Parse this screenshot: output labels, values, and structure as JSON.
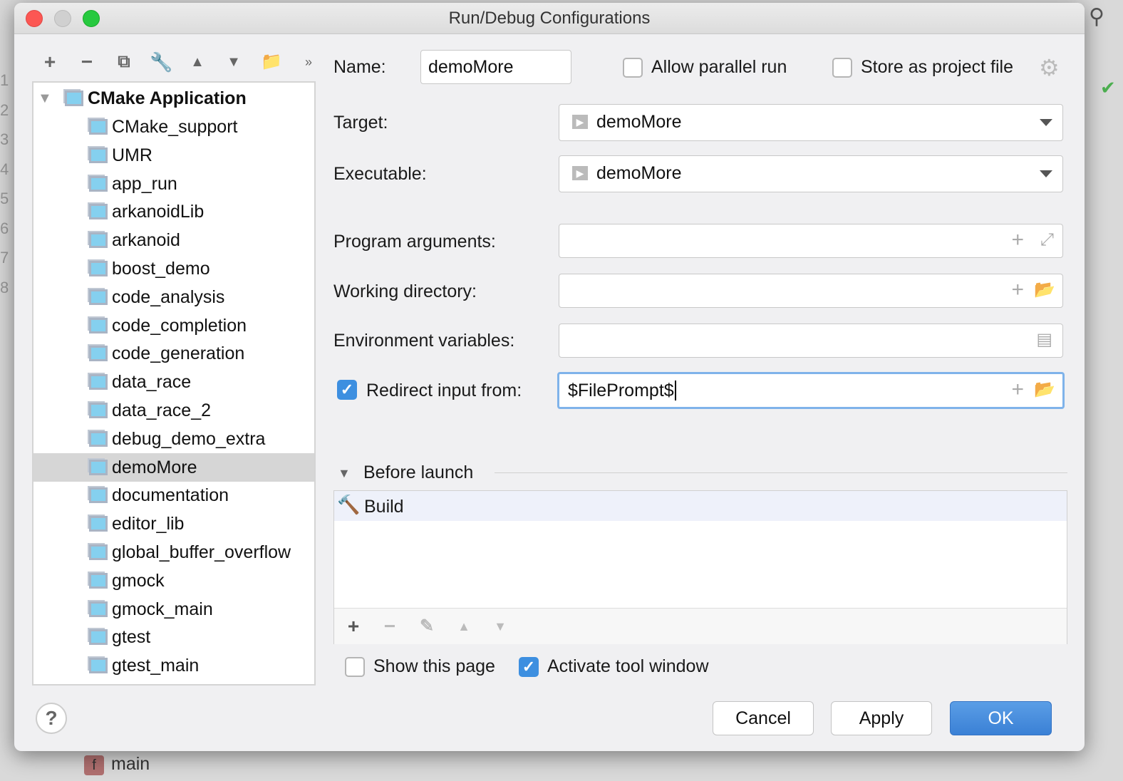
{
  "background": {
    "gutter_lines": [
      "1",
      "2",
      "3",
      "4",
      "5",
      "6",
      "7",
      "8"
    ],
    "bottom_item": {
      "badge": "f",
      "label": "main"
    }
  },
  "dialog": {
    "title": "Run/Debug Configurations"
  },
  "toolbar": {
    "icons": [
      "plus-icon",
      "minus-icon",
      "copy-icon",
      "wrench-icon",
      "move-up-icon",
      "move-down-icon",
      "new-folder-icon",
      "more-icon"
    ]
  },
  "tree": {
    "root": "CMake Application",
    "items": [
      "CMake_support",
      "UMR",
      "app_run",
      "arkanoidLib",
      "arkanoid",
      "boost_demo",
      "code_analysis",
      "code_completion",
      "code_generation",
      "data_race",
      "data_race_2",
      "debug_demo_extra",
      "demoMore",
      "documentation",
      "editor_lib",
      "global_buffer_overflow",
      "gmock",
      "gmock_main",
      "gtest",
      "gtest_main"
    ],
    "selected": "demoMore"
  },
  "form": {
    "name_label": "Name:",
    "name_value": "demoMore",
    "allow_parallel": {
      "label": "Allow parallel run",
      "checked": false
    },
    "store_project": {
      "label": "Store as project file",
      "checked": false
    },
    "target_label": "Target:",
    "target_value": "demoMore",
    "executable_label": "Executable:",
    "executable_value": "demoMore",
    "program_args_label": "Program arguments:",
    "program_args_value": "",
    "working_dir_label": "Working directory:",
    "working_dir_value": "",
    "env_label": "Environment variables:",
    "env_value": "",
    "redirect": {
      "label": "Redirect input from:",
      "checked": true,
      "value": "$FilePrompt$"
    }
  },
  "before_launch": {
    "title": "Before launch",
    "items": [
      "Build"
    ]
  },
  "options": {
    "show_page": {
      "label": "Show this page",
      "checked": false
    },
    "activate_tool": {
      "label": "Activate tool window",
      "checked": true
    }
  },
  "buttons": {
    "help": "?",
    "cancel": "Cancel",
    "apply": "Apply",
    "ok": "OK"
  },
  "colors": {
    "accent": "#3d8fe0",
    "ok_button": "#3d82d6"
  }
}
